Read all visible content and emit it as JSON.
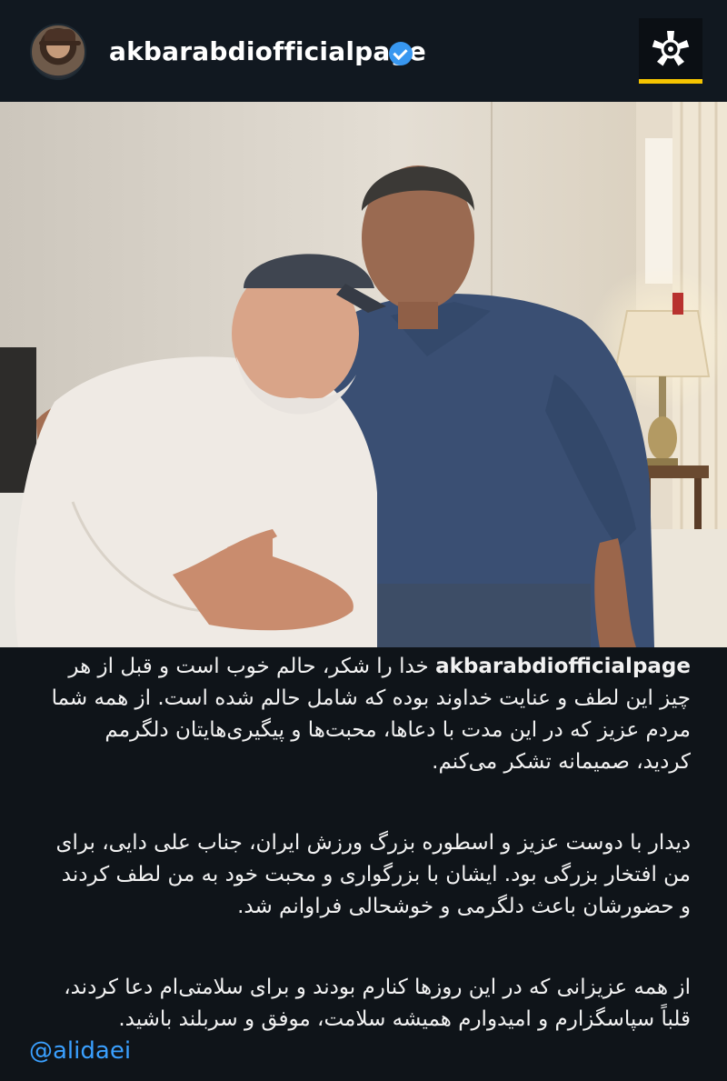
{
  "header": {
    "username": "akbarabdiofficialpage",
    "avatar_icon": "profile-photo",
    "verified_icon": "verified-badge-icon",
    "logo_icon": "media-outlet-logo-icon",
    "colors": {
      "background": "#111820",
      "verified": "#3897f0",
      "logo_accent": "#f5c400"
    }
  },
  "post": {
    "image_subject": "photo"
  },
  "caption": {
    "username": "akbarabdiofficialpage",
    "p1": [
      "خدا را شکر، حالم خوب است و قبل از هر",
      "چیز این لطف و عنایت خداوند بوده که شامل حالم شده است. از همه شما",
      "مردم عزیز که در این مدت با دعاها، محبت‌ها و پیگیری‌هایتان دلگرمم",
      "کردید، صمیمانه تشکر می‌کنم."
    ],
    "p2": [
      "دیدار با دوست عزیز و اسطوره بزرگ ورزش ایران، جناب علی دایی، برای",
      "من افتخار بزرگی بود. ایشان با بزرگواری و محبت خود به من لطف کردند",
      "و حضورشان باعث دلگرمی و خوشحالی فراوانم شد."
    ],
    "p3": [
      "از همه عزیزانی که در این روزها کنارم بودند و برای سلامتی‌ام دعا کردند،",
      "قلباً سپاسگزارم و امیدوارم همیشه سلامت، موفق و سربلند باشید."
    ],
    "mention": "@alidaei",
    "colors": {
      "text": "#f2f2f2",
      "mention": "#3aa0ff",
      "background": "#0f1419"
    }
  }
}
